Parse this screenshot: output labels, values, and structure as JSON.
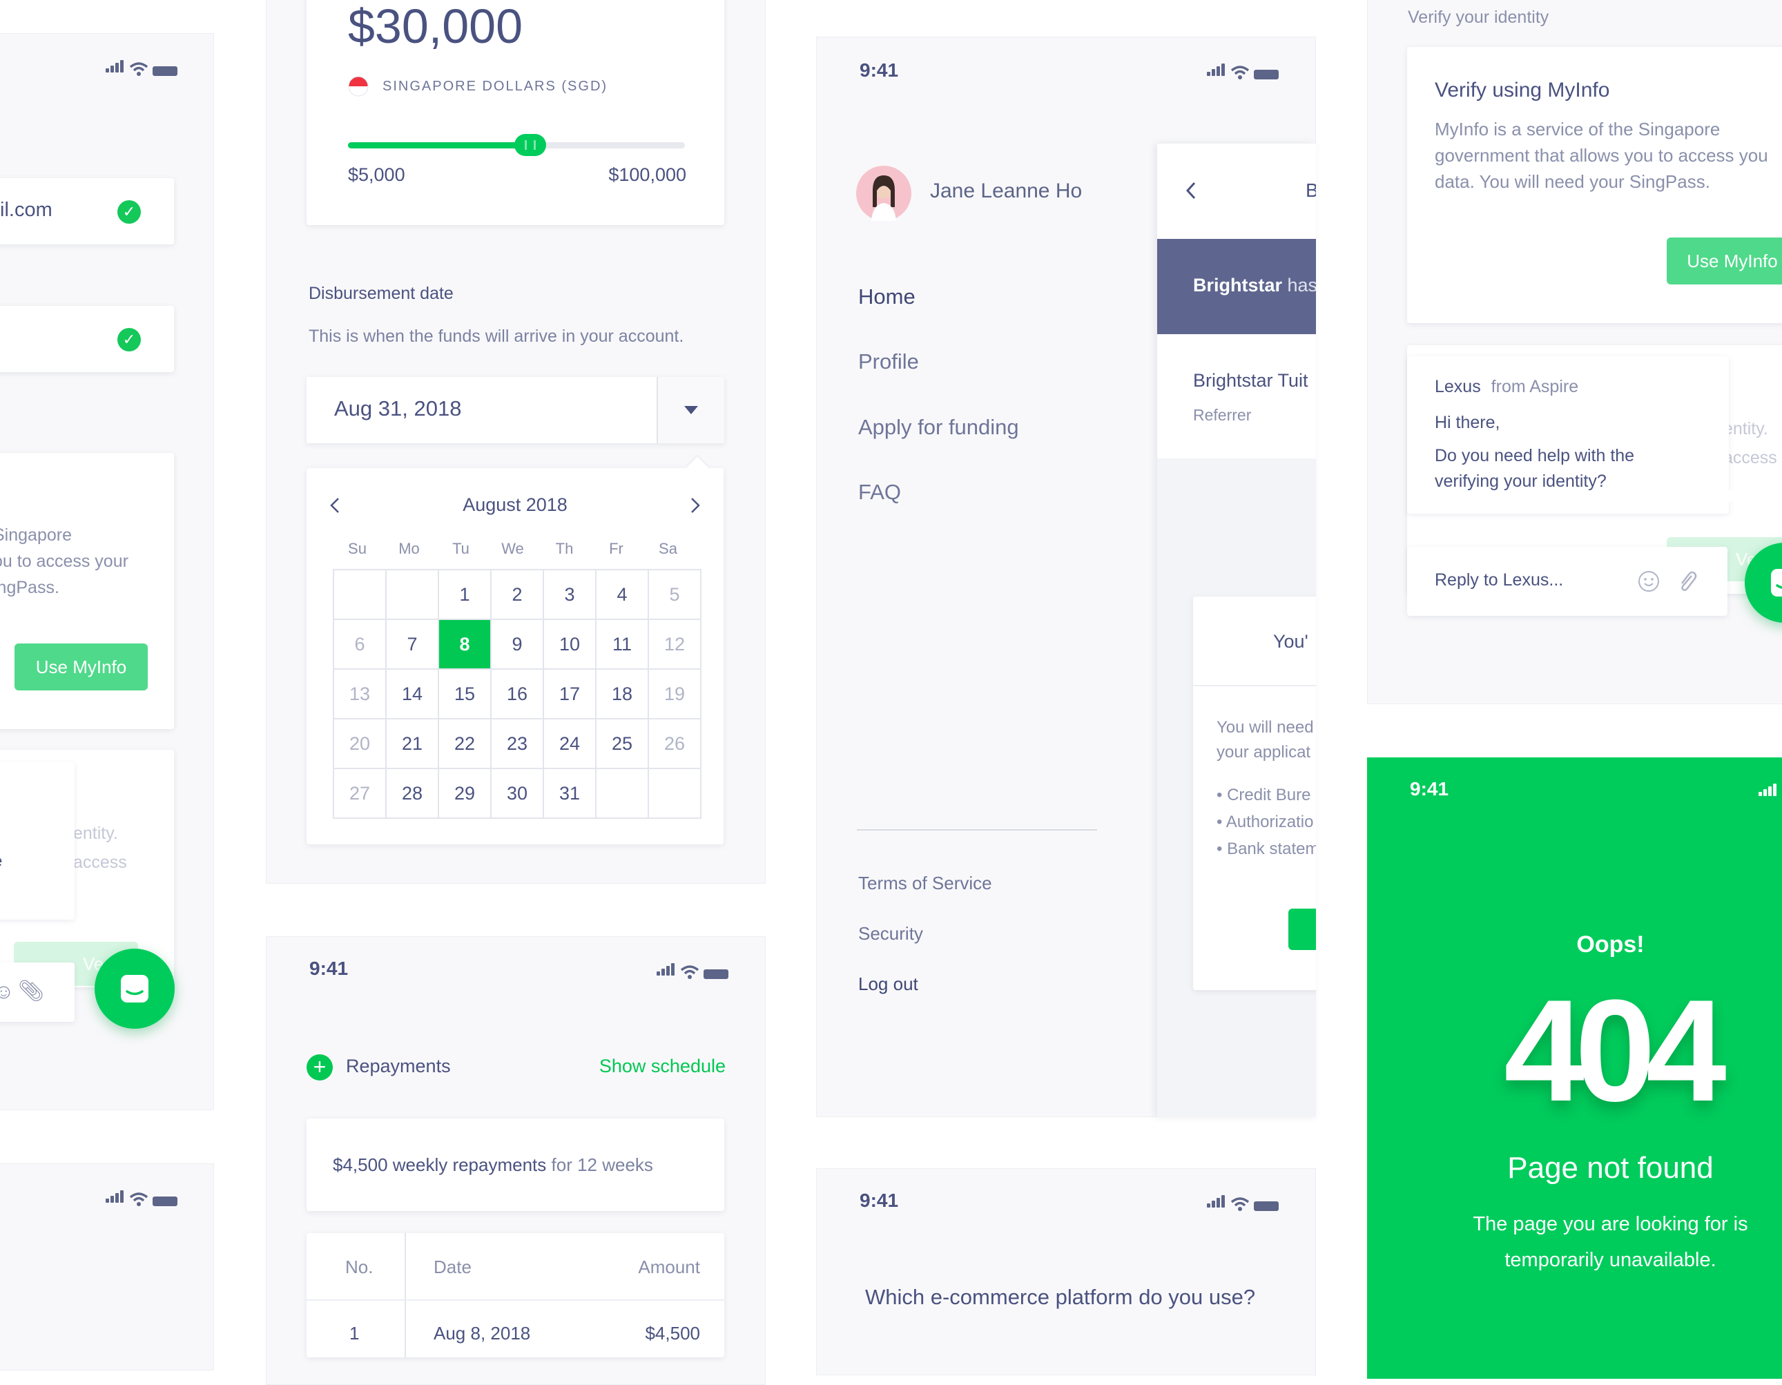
{
  "colors": {
    "accent": "#00c853",
    "navy": "#5e668f",
    "light_green": "#4fd98a"
  },
  "left_phone": {
    "email_partial": "il.com",
    "myinfo_text_lines": [
      "Singapore",
      "ou to access your",
      "ingPass."
    ],
    "use_myinfo": "Use MyInfo",
    "ghost_lines": [
      "entity.",
      "access"
    ],
    "ghost_btn": "Ve",
    "bubble_letter": "e"
  },
  "loan": {
    "amount": "$30,000",
    "currency": "SINGAPORE DOLLARS (SGD)",
    "slider_fill": 0.54,
    "min_label": "$5,000",
    "max_label": "$100,000",
    "disb_title": "Disbursement date",
    "disb_desc": "This is when the funds will arrive in your account.",
    "date_value": "Aug 31, 2018",
    "month_label": "August 2018",
    "weekdays": [
      "Su",
      "Mo",
      "Tu",
      "We",
      "Th",
      "Fr",
      "Sa"
    ],
    "weeks": [
      [
        "",
        "",
        "1",
        "2",
        "3",
        "4",
        "5"
      ],
      [
        "6",
        "7",
        "8",
        "9",
        "10",
        "11",
        "12"
      ],
      [
        "13",
        "14",
        "15",
        "16",
        "17",
        "18",
        "19"
      ],
      [
        "20",
        "21",
        "22",
        "23",
        "24",
        "25",
        "26"
      ],
      [
        "27",
        "28",
        "29",
        "30",
        "31",
        "",
        ""
      ]
    ],
    "selected": "8"
  },
  "repay": {
    "time": "9:41",
    "title": "Repayments",
    "show": "Show schedule",
    "summary_bold": "$4,500 weekly repayments",
    "summary_rest": " for 12 weeks",
    "headers": [
      "No.",
      "Date",
      "Amount"
    ],
    "row": [
      "1",
      "Aug 8, 2018",
      "$4,500"
    ]
  },
  "menu_phone": {
    "time": "9:41",
    "user": "Jane Leanne Ho",
    "items": [
      "Home",
      "Profile",
      "Apply for funding",
      "FAQ"
    ],
    "footer": [
      "Terms of Service",
      "Security",
      "Log out"
    ],
    "peek_header_letter": "B",
    "banner_bold": "Brightstar",
    "banner_rest": " has",
    "ref_name": "Brightstar Tuit",
    "ref_role": "Referrer",
    "modal_title": "You'",
    "modal_lines": [
      "You will need",
      "your applicat"
    ],
    "modal_bullets": [
      "• Credit Bure",
      "• Authorizatio",
      "• Bank statem"
    ]
  },
  "ecom_phone": {
    "time": "9:41",
    "question": "Which e-commerce platform do you use?"
  },
  "verify": {
    "section": "Verify your identity",
    "title": "Verify using MyInfo",
    "desc_lines": [
      "MyInfo is a service of the Singapore",
      "government that allows you to access you",
      "data. You will need your SingPass."
    ],
    "btn": "Use MyInfo",
    "chat_name": "Lexus",
    "chat_from": "from Aspire",
    "chat_greet": "Hi there,",
    "chat_msg_lines": [
      "Do you need help with the",
      "verifying your identity?"
    ],
    "ghost_lines": [
      "entity.",
      "access"
    ],
    "ghost_btn": "Ve",
    "reply_placeholder": "Reply to Lexus..."
  },
  "notfound": {
    "time": "9:41",
    "oops": "Oops!",
    "code": "404",
    "title": "Page not found",
    "desc_lines": [
      "The page you are looking for is",
      "temporarily unavailable."
    ]
  },
  "icons": [
    "check-icon",
    "chat-icon",
    "wifi-icon",
    "signal-icon",
    "battery-icon",
    "chevron-left-icon",
    "chevron-right-icon",
    "caret-down-icon",
    "plus-icon",
    "smiley-icon",
    "paperclip-icon",
    "flag-sg-icon"
  ]
}
